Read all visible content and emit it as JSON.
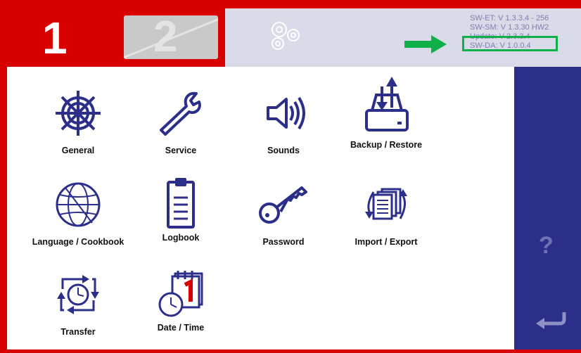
{
  "tabs": [
    {
      "label": "1",
      "active": true
    },
    {
      "label": "2",
      "active": false
    }
  ],
  "gear_icon": "gears-icon",
  "versions": {
    "sw_et": "SW-ET: V 1.3.3.4 - 256",
    "sw_sm": "SW-SM: V 1.3.30 HW2",
    "update": "Update: V 2.3.3.4",
    "sw_da": "SW-DA: V 1.0.0.4"
  },
  "tiles": {
    "general": "General",
    "service": "Service",
    "sounds": "Sounds",
    "backup": "Backup / Restore",
    "language": "Language / Cookbook",
    "logbook": "Logbook",
    "password": "Password",
    "import_export": "Import / Export",
    "transfer": "Transfer",
    "datetime": "Date / Time"
  },
  "sidebar": {
    "help": "?",
    "back_icon": "return-arrow-icon"
  },
  "colors": {
    "brand_red": "#d90000",
    "navy": "#2b2f8a",
    "icon_blue": "#2b2f8a",
    "highlight_green": "#0fb04a"
  }
}
